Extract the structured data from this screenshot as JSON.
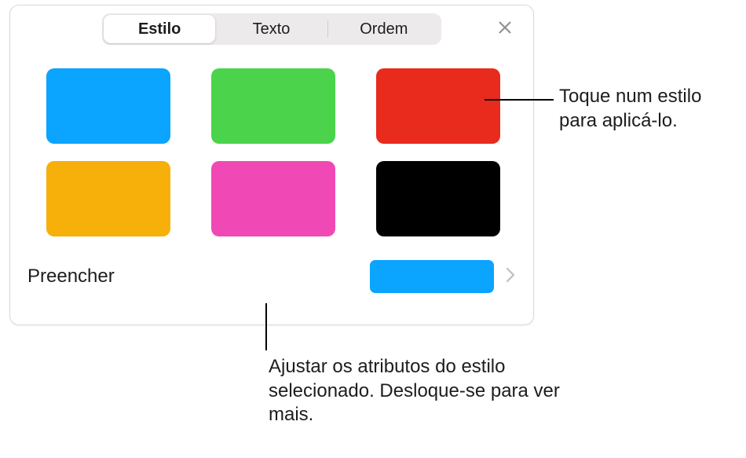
{
  "tabs": {
    "style": "Estilo",
    "text": "Texto",
    "order": "Ordem"
  },
  "swatches": [
    {
      "color": "#0ba4ff"
    },
    {
      "color": "#4bd44b"
    },
    {
      "color": "#e82b1c"
    },
    {
      "color": "#f7af09"
    },
    {
      "color": "#f049b6"
    },
    {
      "color": "#000000"
    }
  ],
  "fill": {
    "label": "Preencher",
    "current_color": "#0ba4ff"
  },
  "callouts": {
    "apply_style": "Toque num estilo para aplicá-lo.",
    "adjust_attributes": "Ajustar os atributos do estilo selecionado. Desloque-se para ver mais."
  }
}
